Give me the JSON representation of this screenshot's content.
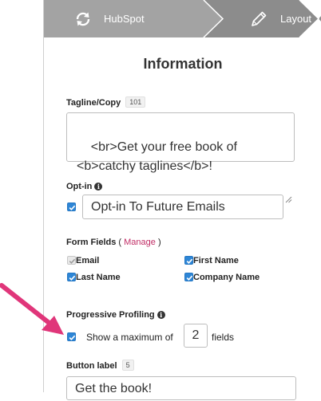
{
  "steps": [
    {
      "label": "HubSpot",
      "icon": "sync-icon"
    },
    {
      "label": "Layout",
      "icon": "pencil-icon"
    }
  ],
  "section_title": "Information",
  "tagline": {
    "label": "Tagline/Copy",
    "count": "101",
    "value": "<br>Get your free book of\n<b>catchy taglines</b>!"
  },
  "optin": {
    "label": "Opt-in",
    "checked": true,
    "value": "Opt-in To Future Emails"
  },
  "form_fields": {
    "label": "Form Fields",
    "open_paren": "(",
    "manage_label": "Manage",
    "close_paren": ")",
    "items": [
      {
        "label": "Email",
        "checked": true,
        "disabled": true
      },
      {
        "label": "First Name",
        "checked": true,
        "disabled": false
      },
      {
        "label": "Last Name",
        "checked": true,
        "disabled": false
      },
      {
        "label": "Company Name",
        "checked": true,
        "disabled": false
      }
    ]
  },
  "progressive_profiling": {
    "label": "Progressive Profiling",
    "checked": true,
    "prefix": "Show a maximum of",
    "value": "2",
    "suffix": "fields"
  },
  "button_label": {
    "label": "Button label",
    "count": "5",
    "value": "Get the book!"
  },
  "colors": {
    "accent": "#2e86d6",
    "link": "#c12e66",
    "annotation_arrow": "#e0367a",
    "step_active": "#8c8c8c",
    "step_inactive": "#a8a8a8"
  }
}
